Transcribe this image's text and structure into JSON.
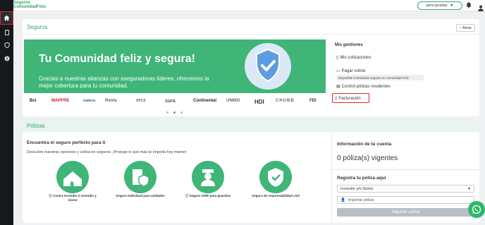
{
  "brand": {
    "line1": "Seguros",
    "line2": "ComunidadFeliz"
  },
  "topbar": {
    "user_label": "peru prueba"
  },
  "seguros": {
    "title": "Seguros",
    "back_label": "Atrás",
    "banner_title": "Tu Comunidad feliz y segura!",
    "banner_text": "Gracias a nuestras alianzas con aseguradoras líderes, ofrecemos la mejor cobertura para tu comunidad.",
    "logos": [
      "Bci",
      "MAPFRE",
      "ZURICH",
      "Renta",
      "SPCS",
      "sura",
      "Continental",
      "UNNIO",
      "HDI",
      "CHUBB",
      "FID"
    ]
  },
  "gestiones": {
    "title": "Mis gestiones",
    "items": [
      {
        "label": "Mis cotizaciones",
        "icon": "document-icon"
      },
      {
        "label": "Pagar online",
        "icon": "card-icon"
      },
      {
        "label": "Control pólizas residentes",
        "icon": "list-icon"
      },
      {
        "label": "Facturación",
        "icon": "invoice-icon"
      }
    ],
    "pagar_note": "Disponible contratando seguros en Comunidad Feliz"
  },
  "polizas": {
    "title": "Pólizas",
    "subtitle": "Encuentra el seguro perfecto para ti",
    "description": "Descubre nuestras opciones y cotiza en seguros. ¡Protege lo que más te importa hoy mismo!",
    "services": [
      {
        "label": "Contra incendio ó incendio y sismo",
        "icon": "house-fire-icon"
      },
      {
        "label": "Seguro individual para unidades",
        "icon": "building-shield-icon"
      },
      {
        "label": "Seguro OSfE para guardias",
        "icon": "guard-icon"
      },
      {
        "label": "Seguro de responsabilidad civil",
        "icon": "shield-check-icon"
      }
    ]
  },
  "cuenta": {
    "title": "Información de tu cuenta",
    "vigentes": "0 póliza(s) vigentes",
    "register_title": "Registra tu póliza aquí",
    "select_value": "Incendio y/o Sismo",
    "import_placeholder": "Importar póliza",
    "adjuntar_label": "Adjuntar póliza"
  },
  "colors": {
    "brand_green": "#3fb578",
    "sidebar": "#15181d",
    "highlight_red": "#e0242c"
  }
}
